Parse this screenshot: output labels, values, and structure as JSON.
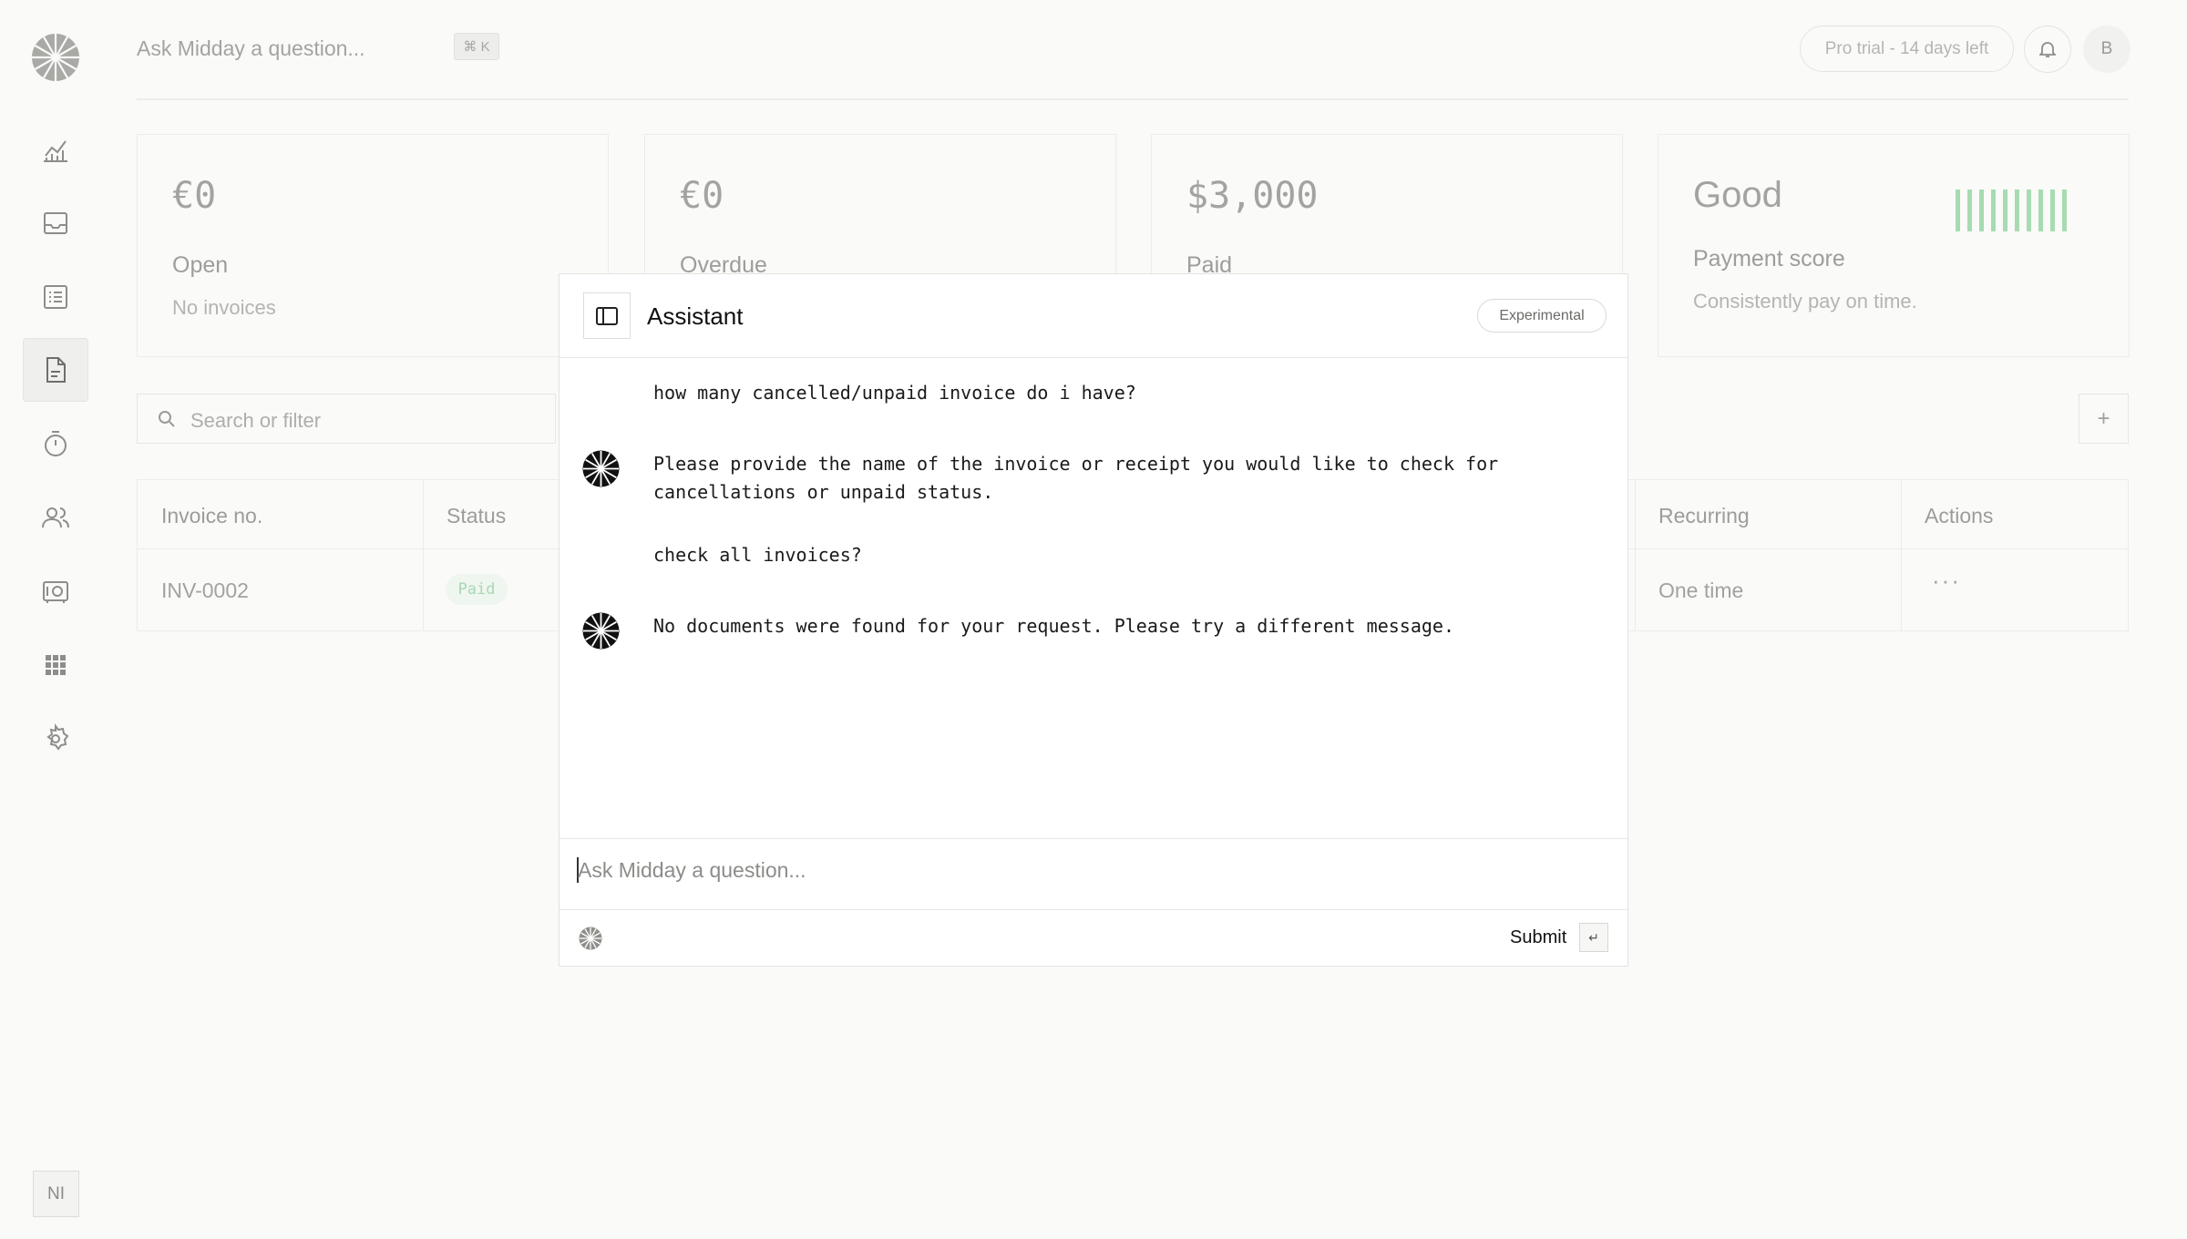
{
  "header": {
    "search_placeholder": "Ask Midday a question...",
    "shortcut": "⌘ K",
    "trial_label": "Pro trial - 14 days left",
    "avatar_initial": "B"
  },
  "sidebar": {
    "items": [
      {
        "name": "overview",
        "icon": "chart-icon",
        "active": false
      },
      {
        "name": "inbox",
        "icon": "inbox-icon",
        "active": false
      },
      {
        "name": "transactions",
        "icon": "list-icon",
        "active": false
      },
      {
        "name": "invoices",
        "icon": "document-icon",
        "active": true
      },
      {
        "name": "tracker",
        "icon": "timer-icon",
        "active": false
      },
      {
        "name": "customers",
        "icon": "users-icon",
        "active": false
      },
      {
        "name": "vault",
        "icon": "vault-icon",
        "active": false
      },
      {
        "name": "apps",
        "icon": "grid-icon",
        "active": false
      },
      {
        "name": "settings",
        "icon": "gear-icon",
        "active": false
      }
    ],
    "footer_badge": "NI"
  },
  "summary": {
    "open": {
      "amount": "€0",
      "label": "Open",
      "sub": "No invoices"
    },
    "overdue": {
      "amount": "€0",
      "label": "Overdue"
    },
    "paid": {
      "amount": "$3,000",
      "label": "Paid"
    },
    "score": {
      "title": "Good",
      "label": "Payment score",
      "sub": "Consistently pay on time.",
      "bar_color": "#a7dbb1",
      "bar_count": 10
    }
  },
  "filter": {
    "placeholder": "Search or filter",
    "add_label": "+"
  },
  "table": {
    "columns": [
      "Invoice no.",
      "Status",
      "Recurring",
      "Actions"
    ],
    "rows": [
      {
        "invoice_no": "INV-0002",
        "status": "Paid",
        "recurring": "One time",
        "actions": "···"
      }
    ]
  },
  "assistant": {
    "title": "Assistant",
    "badge": "Experimental",
    "messages": [
      {
        "role": "user",
        "text": "how many cancelled/unpaid invoice do i have?"
      },
      {
        "role": "assistant",
        "text": "Please provide the name of the invoice or receipt you would like to check for\ncancellations or unpaid status."
      },
      {
        "role": "user",
        "text": "check all invoices?"
      },
      {
        "role": "assistant",
        "text": "No documents were found for your request. Please try a different message."
      }
    ],
    "input_placeholder": "Ask Midday a question...",
    "submit_label": "Submit",
    "enter_key": "↵"
  },
  "colors": {
    "accent_green": "#a7dbb1",
    "background": "#fafaf9",
    "dialog_bg": "#ffffff"
  }
}
